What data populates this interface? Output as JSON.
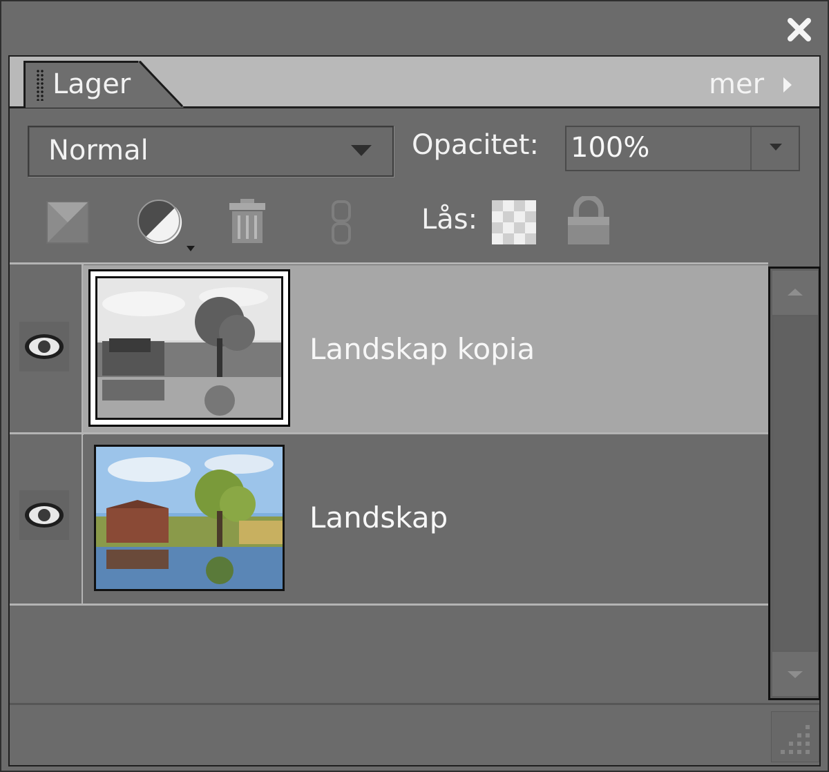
{
  "panel": {
    "tab_label": "Lager",
    "more_label": "mer",
    "close_icon": "close-icon"
  },
  "blend": {
    "value": "Normal"
  },
  "opacity": {
    "label": "Opacitet:",
    "value": "100%"
  },
  "toolbar": {
    "lock_label": "Lås:",
    "icons": [
      "new-layer-icon",
      "adjustment-layer-icon",
      "trash-icon",
      "link-icon",
      "lock-transparency-icon",
      "lock-all-icon"
    ]
  },
  "layers": [
    {
      "name": "Landskap kopia",
      "visible": true,
      "selected": true
    },
    {
      "name": "Landskap",
      "visible": true,
      "selected": false
    }
  ],
  "colors": {
    "panel_bg": "#6b6b6b",
    "tab_bar": "#b9b9b9",
    "selected_row": "#a7a7a7"
  }
}
